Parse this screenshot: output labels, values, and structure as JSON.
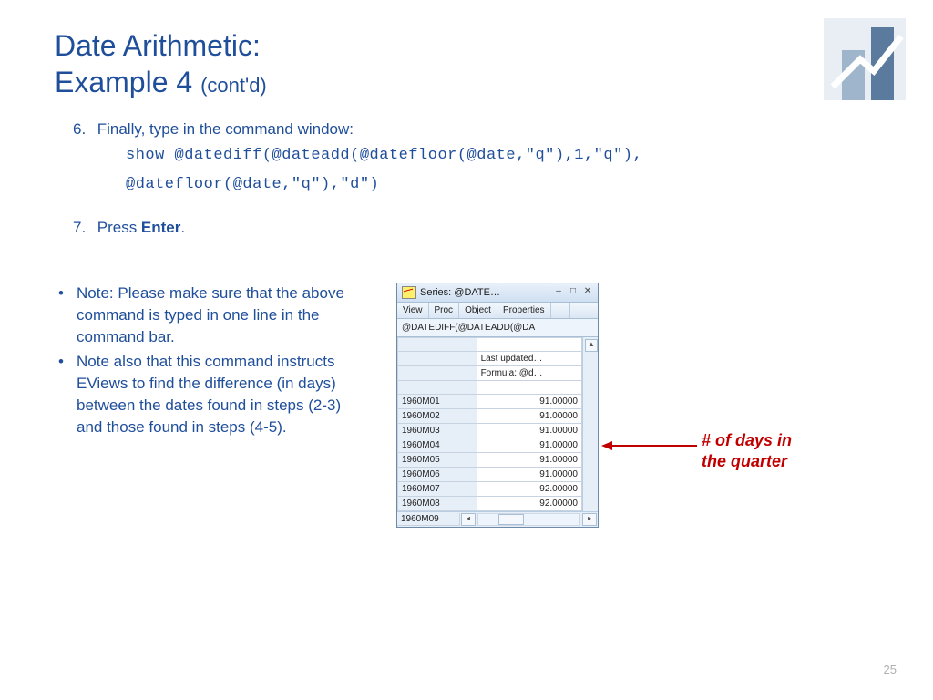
{
  "title": {
    "line1": "Date Arithmetic:",
    "line2": "Example 4",
    "contd": "(cont'd)"
  },
  "steps": {
    "s6": {
      "num": "6.",
      "text": "Finally, type in the command window:"
    },
    "code_line1": "show @datediff(@dateadd(@datefloor(@date,\"q\"),1,\"q\"),",
    "code_line2": "@datefloor(@date,\"q\"),\"d\")",
    "s7": {
      "num": "7.",
      "prefix": "Press ",
      "bold": "Enter",
      "suffix": "."
    }
  },
  "notes": {
    "b1": "Note: Please make sure that the above command is typed in one line in the command bar.",
    "b2": "Note also that this command instructs EViews to find the difference (in days) between the dates found in steps (2-3) and those found in steps (4-5)."
  },
  "ev": {
    "title": "Series: @DATE…",
    "toolbar": {
      "t1": "View",
      "t2": "Proc",
      "t3": "Object",
      "t4": "Properties"
    },
    "formula": "@DATEDIFF(@DATEADD(@DA",
    "info": {
      "last": "Last updated…",
      "formula_lbl": "Formula: @d…"
    },
    "rows": [
      {
        "k": "1960M01",
        "v": "91.00000"
      },
      {
        "k": "1960M02",
        "v": "91.00000"
      },
      {
        "k": "1960M03",
        "v": "91.00000"
      },
      {
        "k": "1960M04",
        "v": "91.00000"
      },
      {
        "k": "1960M05",
        "v": "91.00000"
      },
      {
        "k": "1960M06",
        "v": "91.00000"
      },
      {
        "k": "1960M07",
        "v": "92.00000"
      },
      {
        "k": "1960M08",
        "v": "92.00000"
      }
    ],
    "last_row_key": "1960M09"
  },
  "callout": {
    "l1": "# of days in",
    "l2": "the quarter"
  },
  "page_number": "25"
}
